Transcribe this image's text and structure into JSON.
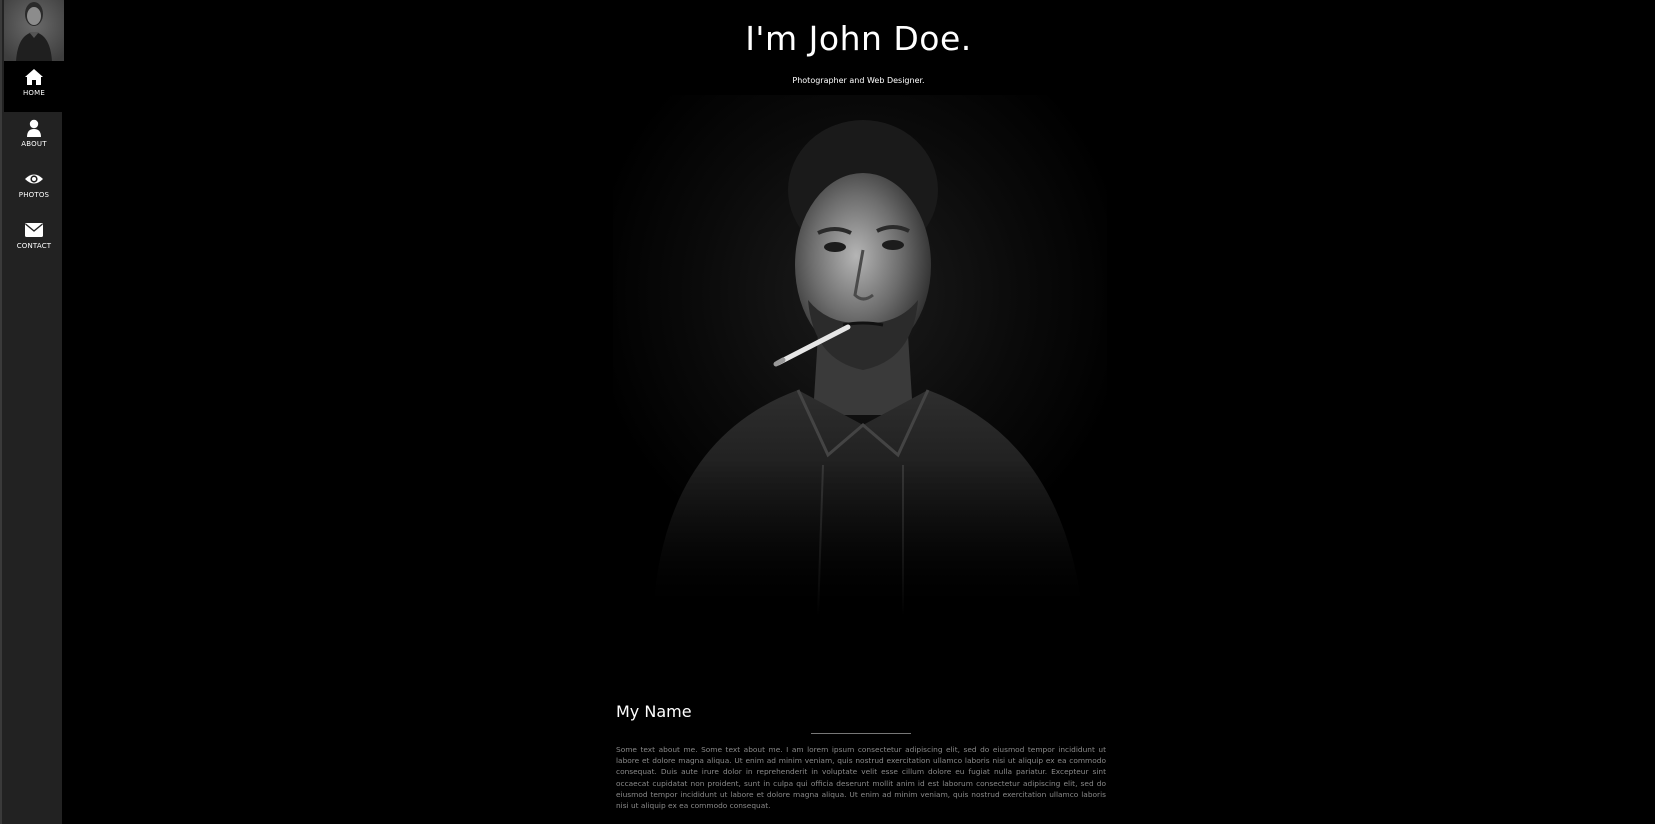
{
  "sidebar": {
    "avatar_alt": "avatar",
    "items": [
      {
        "label": "HOME",
        "icon": "home-icon",
        "active": true
      },
      {
        "label": "ABOUT",
        "icon": "user-icon",
        "active": false
      },
      {
        "label": "PHOTOS",
        "icon": "eye-icon",
        "active": false
      },
      {
        "label": "CONTACT",
        "icon": "envelope-icon",
        "active": false
      }
    ]
  },
  "header": {
    "title": "I'm John Doe.",
    "subtitle": "Photographer and Web Designer."
  },
  "about": {
    "heading": "My Name",
    "text": "Some text about me. Some text about me. I am lorem ipsum consectetur adipiscing elit, sed do eiusmod tempor incididunt ut labore et dolore magna aliqua. Ut enim ad minim veniam, quis nostrud exercitation ullamco laboris nisi ut aliquip ex ea commodo consequat. Duis aute irure dolor in reprehenderit in voluptate velit esse cillum dolore eu fugiat nulla pariatur. Excepteur sint occaecat cupidatat non proident, sunt in culpa qui officia deserunt mollit anim id est laborum consectetur adipiscing elit, sed do eiusmod tempor incididunt ut labore et dolore magna aliqua. Ut enim ad minim veniam, quis nostrud exercitation ullamco laboris nisi ut aliquip ex ea commodo consequat."
  },
  "colors": {
    "background": "#000000",
    "sidebar": "#222222",
    "active_nav": "#000000",
    "body_text": "#8a8a8a"
  }
}
